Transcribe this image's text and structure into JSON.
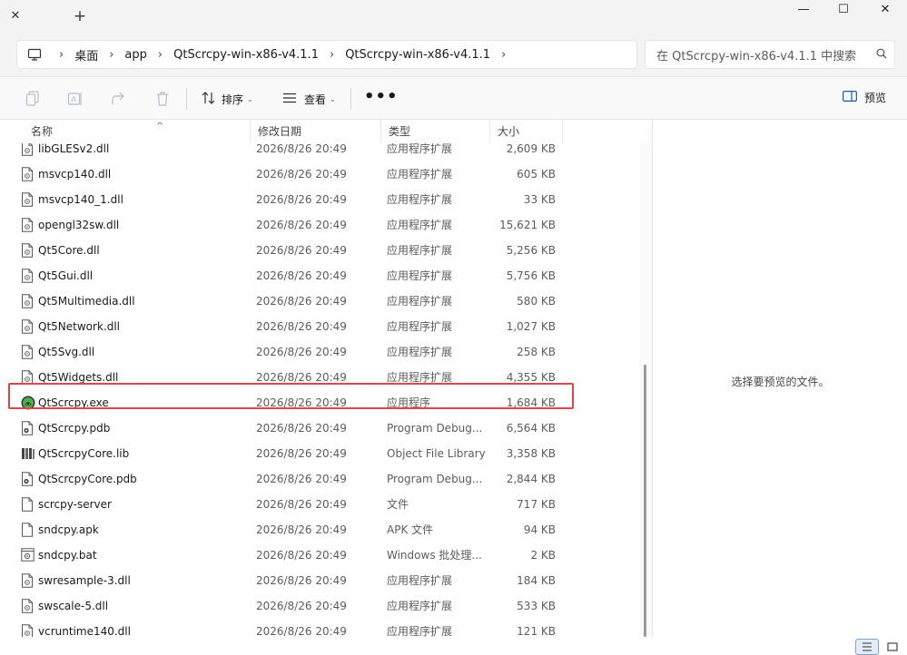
{
  "window": {
    "tab_close_glyph": "✕",
    "new_tab_glyph": "+",
    "minimize_glyph": "—",
    "maximize_glyph": "☐",
    "close_glyph": "✕"
  },
  "breadcrumb": {
    "items": [
      "桌面",
      "app",
      "QtScrcpy-win-x86-v4.1.1",
      "QtScrcpy-win-x86-v4.1.1"
    ],
    "separator": "›"
  },
  "search": {
    "placeholder": "在 QtScrcpy-win-x86-v4.1.1 中搜索"
  },
  "toolbar": {
    "sort_label": "排序",
    "view_label": "查看",
    "more_label": "•••",
    "preview_label": "预览"
  },
  "columns": {
    "name": "名称",
    "date": "修改日期",
    "type": "类型",
    "size": "大小"
  },
  "files": [
    {
      "name": "libGLESv2.dll",
      "date": "2026/8/26 20:49",
      "type": "应用程序扩展",
      "size": "2,609 KB",
      "icon": "dll-file-icon"
    },
    {
      "name": "msvcp140.dll",
      "date": "2026/8/26 20:49",
      "type": "应用程序扩展",
      "size": "605 KB",
      "icon": "dll-file-icon"
    },
    {
      "name": "msvcp140_1.dll",
      "date": "2026/8/26 20:49",
      "type": "应用程序扩展",
      "size": "33 KB",
      "icon": "dll-file-icon"
    },
    {
      "name": "opengl32sw.dll",
      "date": "2026/8/26 20:49",
      "type": "应用程序扩展",
      "size": "15,621 KB",
      "icon": "dll-file-icon"
    },
    {
      "name": "Qt5Core.dll",
      "date": "2026/8/26 20:49",
      "type": "应用程序扩展",
      "size": "5,256 KB",
      "icon": "dll-file-icon"
    },
    {
      "name": "Qt5Gui.dll",
      "date": "2026/8/26 20:49",
      "type": "应用程序扩展",
      "size": "5,756 KB",
      "icon": "dll-file-icon"
    },
    {
      "name": "Qt5Multimedia.dll",
      "date": "2026/8/26 20:49",
      "type": "应用程序扩展",
      "size": "580 KB",
      "icon": "dll-file-icon"
    },
    {
      "name": "Qt5Network.dll",
      "date": "2026/8/26 20:49",
      "type": "应用程序扩展",
      "size": "1,027 KB",
      "icon": "dll-file-icon"
    },
    {
      "name": "Qt5Svg.dll",
      "date": "2026/8/26 20:49",
      "type": "应用程序扩展",
      "size": "258 KB",
      "icon": "dll-file-icon"
    },
    {
      "name": "Qt5Widgets.dll",
      "date": "2026/8/26 20:49",
      "type": "应用程序扩展",
      "size": "4,355 KB",
      "icon": "dll-file-icon"
    },
    {
      "name": "QtScrcpy.exe",
      "date": "2026/8/26 20:49",
      "type": "应用程序",
      "size": "1,684 KB",
      "icon": "app-exe-icon",
      "highlighted": true
    },
    {
      "name": "QtScrcpy.pdb",
      "date": "2026/8/26 20:49",
      "type": "Program Debug...",
      "size": "6,564 KB",
      "icon": "pdb-file-icon"
    },
    {
      "name": "QtScrcpyCore.lib",
      "date": "2026/8/26 20:49",
      "type": "Object File Library",
      "size": "3,358 KB",
      "icon": "lib-file-icon"
    },
    {
      "name": "QtScrcpyCore.pdb",
      "date": "2026/8/26 20:49",
      "type": "Program Debug...",
      "size": "2,844 KB",
      "icon": "pdb-file-icon"
    },
    {
      "name": "scrcpy-server",
      "date": "2026/8/26 20:49",
      "type": "文件",
      "size": "717 KB",
      "icon": "blank-file-icon"
    },
    {
      "name": "sndcpy.apk",
      "date": "2026/8/26 20:49",
      "type": "APK 文件",
      "size": "94 KB",
      "icon": "blank-file-icon"
    },
    {
      "name": "sndcpy.bat",
      "date": "2026/8/26 20:49",
      "type": "Windows 批处理...",
      "size": "2 KB",
      "icon": "bat-file-icon"
    },
    {
      "name": "swresample-3.dll",
      "date": "2026/8/26 20:49",
      "type": "应用程序扩展",
      "size": "184 KB",
      "icon": "dll-file-icon"
    },
    {
      "name": "swscale-5.dll",
      "date": "2026/8/26 20:49",
      "type": "应用程序扩展",
      "size": "533 KB",
      "icon": "dll-file-icon"
    },
    {
      "name": "vcruntime140.dll",
      "date": "2026/8/26 20:49",
      "type": "应用程序扩展",
      "size": "121 KB",
      "icon": "dll-file-icon"
    }
  ],
  "preview_pane": {
    "message": "选择要预览的文件。"
  },
  "colors": {
    "highlight_border": "#e0474c",
    "accent": "#0067c0",
    "exe_icon": "#4caf50"
  }
}
